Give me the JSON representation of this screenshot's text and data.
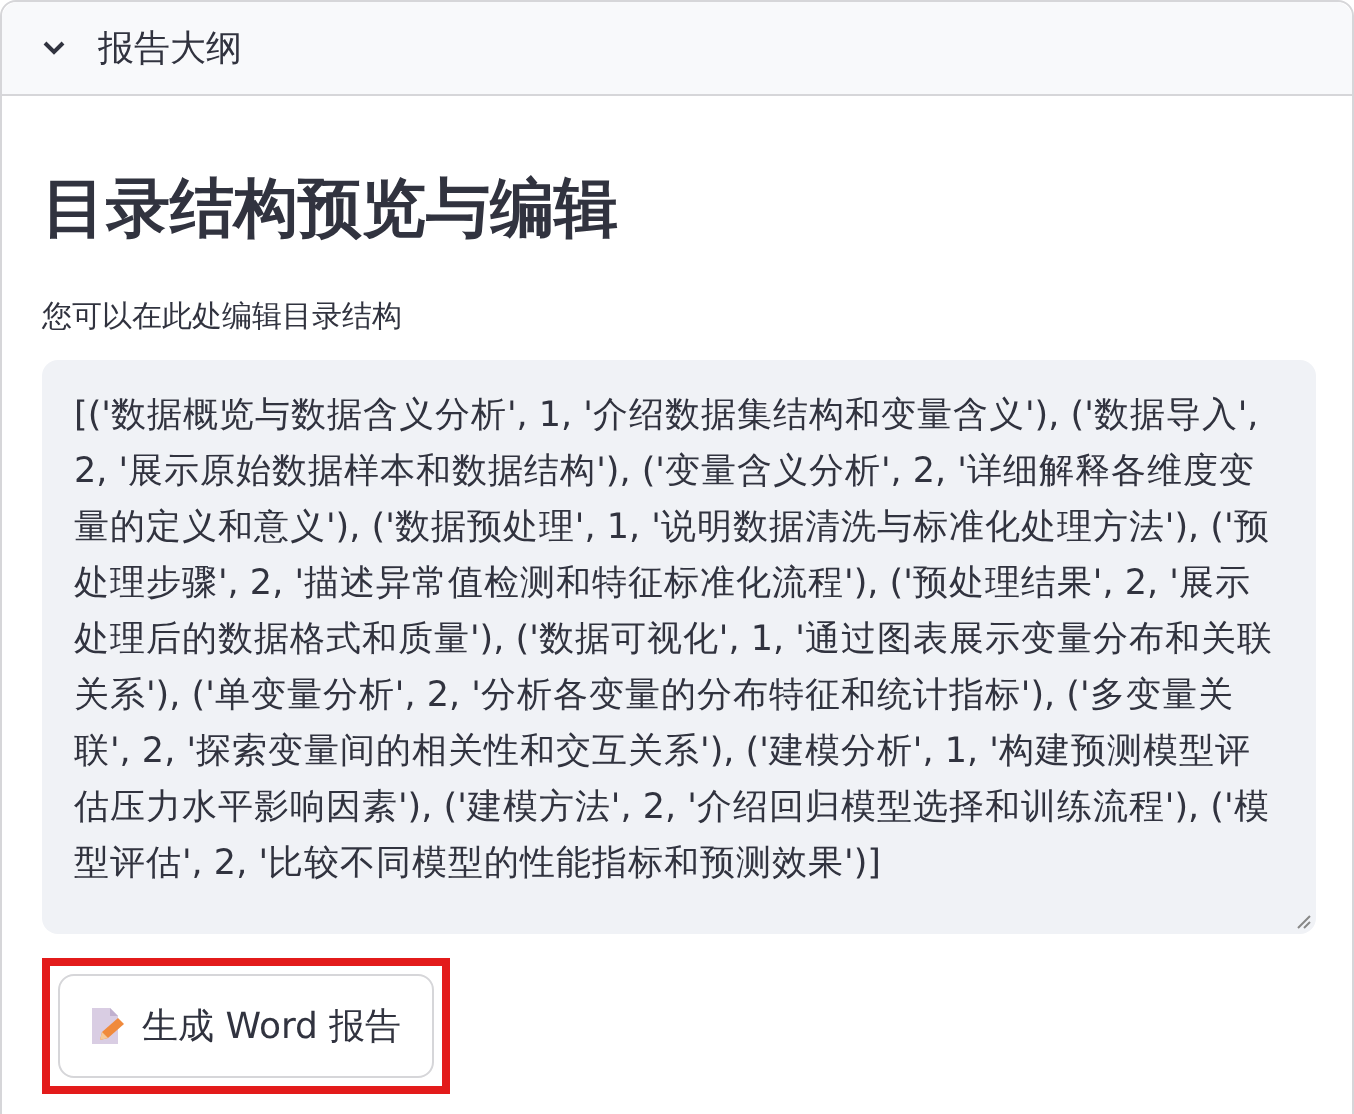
{
  "expander": {
    "title": "报告大纲",
    "expanded": true
  },
  "heading": "目录结构预览与编辑",
  "editor": {
    "label": "您可以在此处编辑目录结构",
    "value": "[('数据概览与数据含义分析', 1, '介绍数据集结构和变量含义'), ('数据导入', 2, '展示原始数据样本和数据结构'), ('变量含义分析', 2, '详细解释各维度变量的定义和意义'), ('数据预处理', 1, '说明数据清洗与标准化处理方法'), ('预处理步骤', 2, '描述异常值检测和特征标准化流程'), ('预处理结果', 2, '展示处理后的数据格式和质量'), ('数据可视化', 1, '通过图表展示变量分布和关联关系'), ('单变量分析', 2, '分析各变量的分布特征和统计指标'), ('多变量关联', 2, '探索变量间的相关性和交互关系'), ('建模分析', 1, '构建预测模型评估压力水平影响因素'), ('建模方法', 2, '介绍回归模型选择和训练流程'), ('模型评估', 2, '比较不同模型的性能指标和预测效果')]"
  },
  "button": {
    "label": "生成 Word 报告",
    "highlighted": true
  }
}
